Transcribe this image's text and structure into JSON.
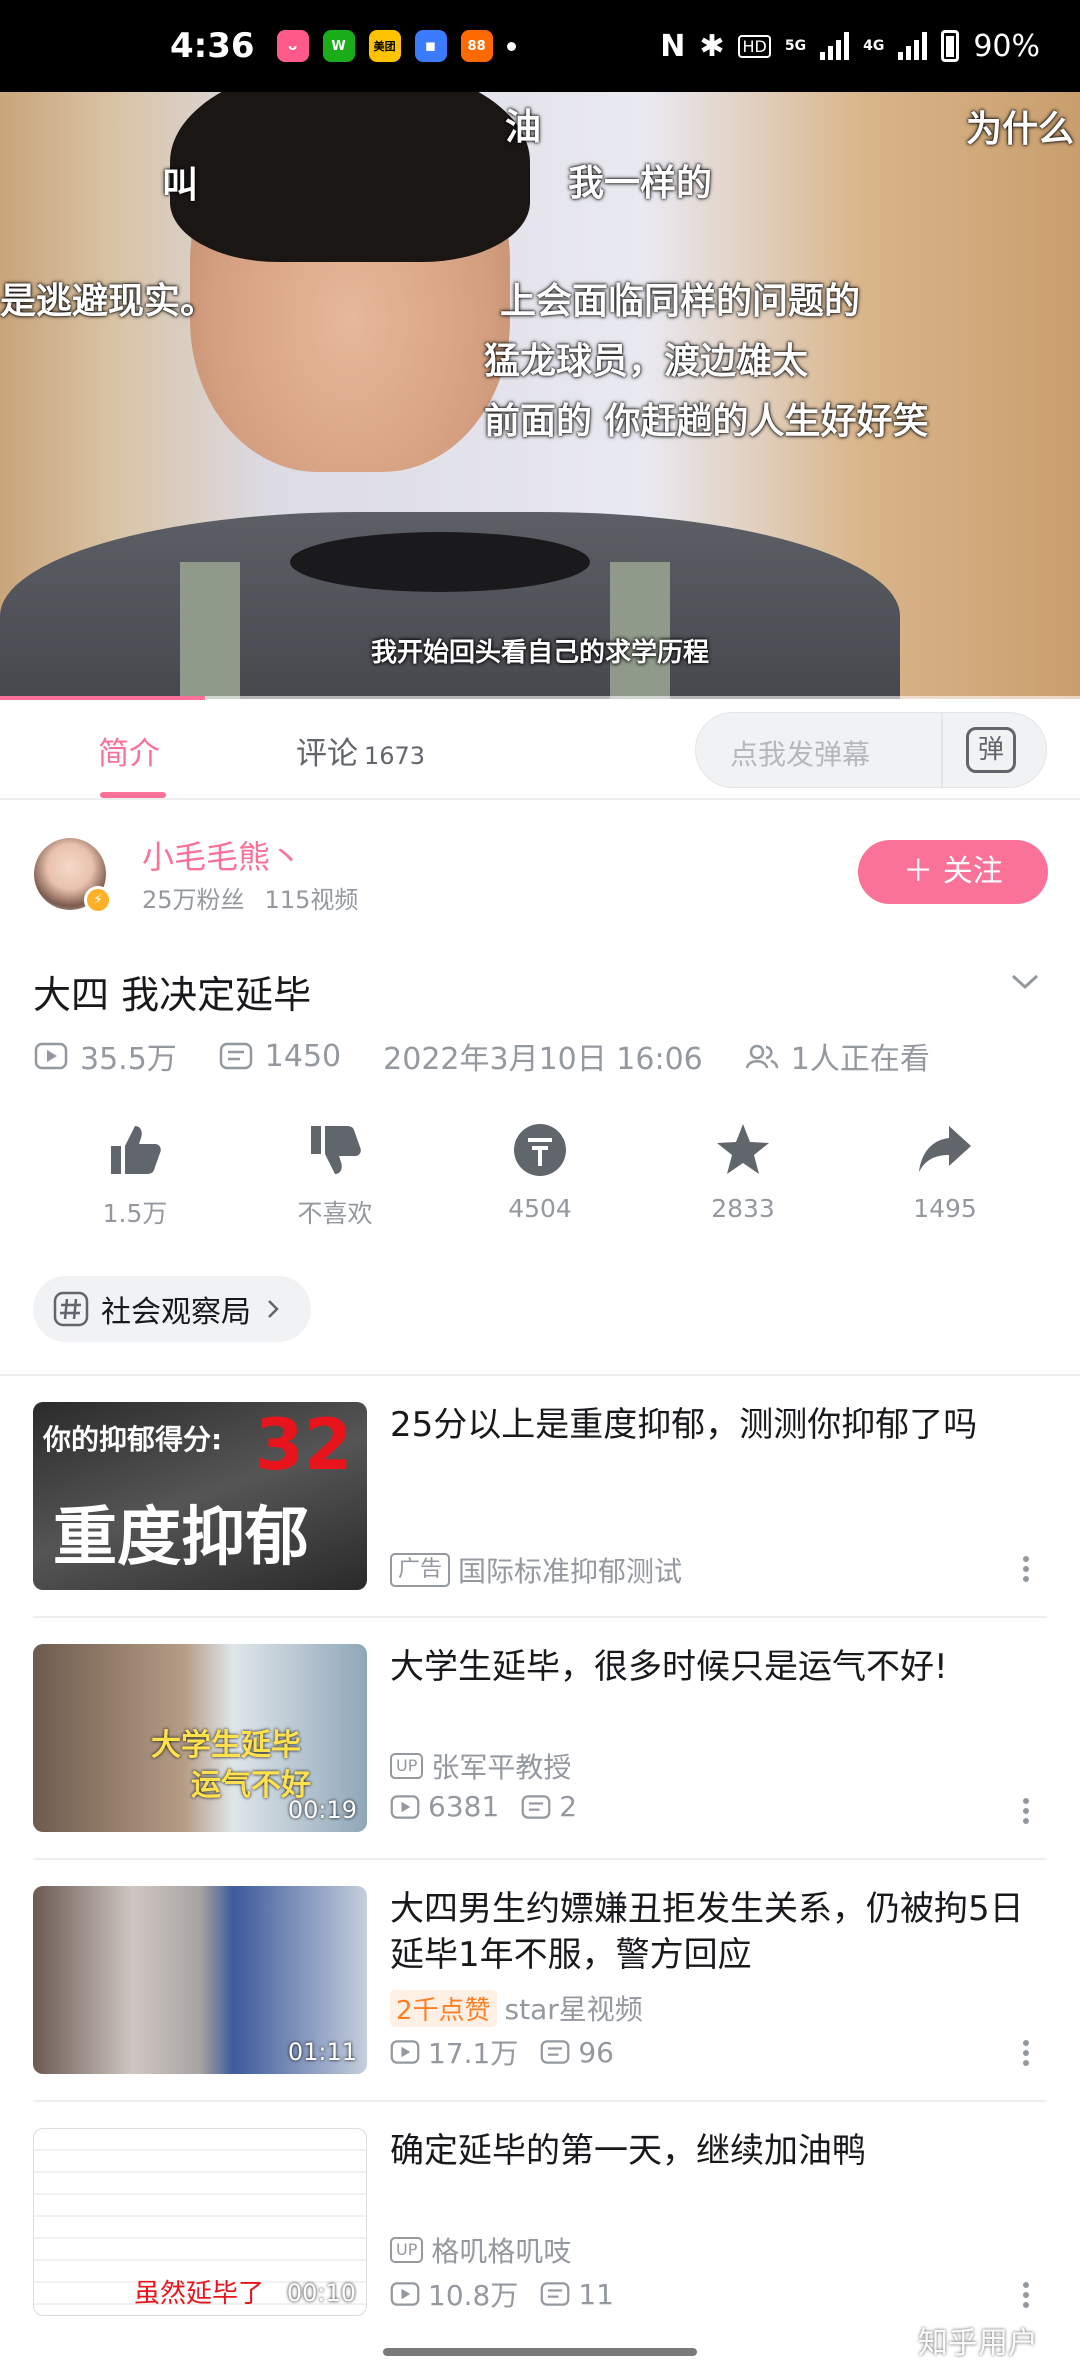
{
  "status_bar": {
    "time": "4:36",
    "apps": [
      {
        "name": "app-icon-1",
        "color": "#ff5a8a",
        "label": "ᴗ"
      },
      {
        "name": "wechat-icon",
        "color": "#1aad19",
        "label": "W"
      },
      {
        "name": "meituan-icon",
        "color": "#ffc300",
        "label": "美团"
      },
      {
        "name": "app-icon-4",
        "color": "#3b7cff",
        "label": "◼"
      },
      {
        "name": "app-icon-5",
        "color": "#ff6a00",
        "label": "88"
      }
    ],
    "nfc": "N",
    "bluetooth": "✱",
    "hd": "HD",
    "network_1": "5G",
    "network_2": "4G",
    "battery": "90%"
  },
  "video": {
    "subtitle": "我开始回头看自己的求学历程",
    "danmaku": [
      {
        "text": "油"
      },
      {
        "text": "为什么"
      },
      {
        "text": "我一样的"
      },
      {
        "text": "叫"
      },
      {
        "text": "是逃避现实。"
      },
      {
        "text": "上会面临同样的问题的"
      },
      {
        "text": "猛龙球员，渡边雄太"
      },
      {
        "text": "前面的 你赶趟的人生好好笑"
      }
    ],
    "progress": 0.19
  },
  "tabs": {
    "intro": "简介",
    "comments": "评论",
    "comment_count": "1673",
    "danmaku_placeholder": "点我发弹幕",
    "danmaku_button": "弹"
  },
  "uploader": {
    "name": "小毛毛熊丶",
    "fans": "25万粉丝",
    "videos": "115视频",
    "follow": "＋ 关注"
  },
  "video_info": {
    "title": "大四 我决定延毕",
    "views": "35.5万",
    "danmaku_count": "1450",
    "date": "2022年3月10日 16:06",
    "watching": "1人正在看"
  },
  "actions": {
    "like": "1.5万",
    "dislike": "不喜欢",
    "coin": "4504",
    "favorite": "2833",
    "share": "1495"
  },
  "tag": "社会观察局",
  "related": [
    {
      "title": "25分以上是重度抑郁，测测你抑郁了吗",
      "badge": "广告",
      "author": "国际标准抑郁测试",
      "thumb_text_a": "你的抑郁得分:",
      "thumb_text_b": "32",
      "thumb_text_c": "重度抑郁"
    },
    {
      "title": "大学生延毕，很多时候只是运气不好!",
      "badge": "UP",
      "author": "张军平教授",
      "views": "6381",
      "danmaku": "2",
      "duration": "00:19",
      "thumb_text_a": "大学生延毕",
      "thumb_text_b": "运气不好"
    },
    {
      "title": "大四男生约嫖嫌丑拒发生关系，仍被拘5日延毕1年不服，警方回应",
      "hot": "2千点赞",
      "author": "star星视频",
      "views": "17.1万",
      "danmaku": "96",
      "duration": "01:11"
    },
    {
      "title": "确定延毕的第一天，继续加油鸭",
      "badge": "UP",
      "author": "格叽格叽吱",
      "views": "10.8万",
      "danmaku": "11",
      "duration": "00:10",
      "thumb_text_a": "虽然延毕了"
    }
  ],
  "watermark": "知乎用户",
  "colors": {
    "accent": "#fb7299",
    "secondary_text": "#9499a0"
  }
}
